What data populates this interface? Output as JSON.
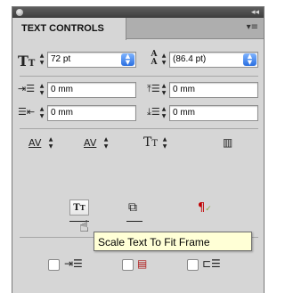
{
  "panel": {
    "tab_label": "TEXT CONTROLS",
    "collapse_glyph": "◂◂",
    "menu_glyph": "▾≡"
  },
  "font_size": {
    "value": "72 pt",
    "icon": "font-size-icon"
  },
  "leading": {
    "value": "(86.4 pt)",
    "icon": "leading-icon"
  },
  "left_indent": {
    "value": "0 mm",
    "icon": "left-indent-icon"
  },
  "space_before": {
    "value": "0 mm",
    "icon": "space-before-icon"
  },
  "right_indent": {
    "value": "0 mm",
    "icon": "right-indent-icon"
  },
  "space_after": {
    "value": "0 mm",
    "icon": "space-after-icon"
  },
  "tooltip": {
    "text": "Scale Text To Fit Frame"
  },
  "icons": {
    "kerning": "kerning-icon",
    "tracking": "tracking-icon",
    "horizontal_scale": "horizontal-scale-icon",
    "columns": "columns-icon",
    "scale_text_to_fit": "scale-text-to-fit-icon",
    "copy_frame": "copy-frame-icon",
    "show_invisibles": "show-invisibles-icon",
    "cursor": "hand-cursor-icon"
  },
  "checkboxes": [
    {
      "name": "auto-kern",
      "checked": false
    },
    {
      "name": "hyphenation",
      "checked": false
    },
    {
      "name": "align-baseline",
      "checked": false
    }
  ]
}
